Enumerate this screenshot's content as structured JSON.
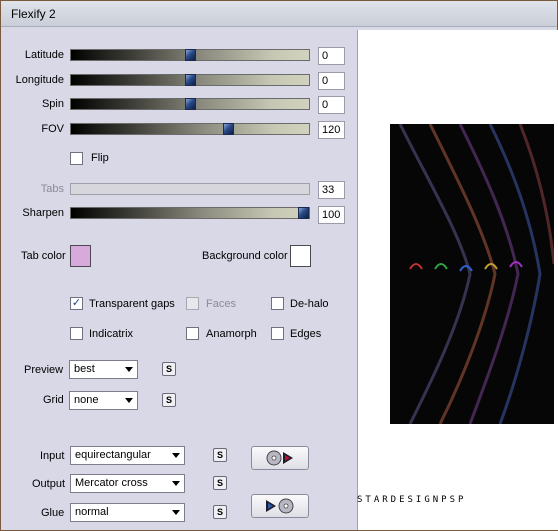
{
  "window": {
    "title": "Flexify 2"
  },
  "sliders": [
    {
      "label": "Latitude",
      "value": "0",
      "fraction": 0.5,
      "enabled": true
    },
    {
      "label": "Longitude",
      "value": "0",
      "fraction": 0.5,
      "enabled": true
    },
    {
      "label": "Spin",
      "value": "0",
      "fraction": 0.5,
      "enabled": true
    },
    {
      "label": "FOV",
      "value": "120",
      "fraction": 0.67,
      "enabled": true
    },
    {
      "label": "Tabs",
      "value": "33",
      "fraction": null,
      "enabled": false
    },
    {
      "label": "Sharpen",
      "value": "100",
      "fraction": 1.0,
      "enabled": true
    }
  ],
  "flip": {
    "label": "Flip",
    "checked": false
  },
  "colors": {
    "tab_label": "Tab color",
    "tab_value": "#d7a9dc",
    "bg_label": "Background color",
    "bg_value": "#ffffff"
  },
  "options": {
    "transparent_gaps": {
      "label": "Transparent gaps",
      "checked": true
    },
    "faces": {
      "label": "Faces",
      "checked": false,
      "enabled": false
    },
    "de_halo": {
      "label": "De-halo",
      "checked": false
    },
    "indicatrix": {
      "label": "Indicatrix",
      "checked": false
    },
    "anamorph": {
      "label": "Anamorph",
      "checked": false
    },
    "edges": {
      "label": "Edges",
      "checked": false
    }
  },
  "preview": {
    "label": "Preview",
    "value": "best"
  },
  "grid": {
    "label": "Grid",
    "value": "none"
  },
  "input": {
    "label": "Input",
    "value": "equirectangular"
  },
  "output": {
    "label": "Output",
    "value": "Mercator cross"
  },
  "glue": {
    "label": "Glue",
    "value": "normal"
  },
  "s_button": {
    "label": "S"
  },
  "icons": {
    "input_button": "disc-to-play-icon",
    "glue_button": "play-to-disc-icon"
  },
  "watermark": "STARDESIGNPSP"
}
